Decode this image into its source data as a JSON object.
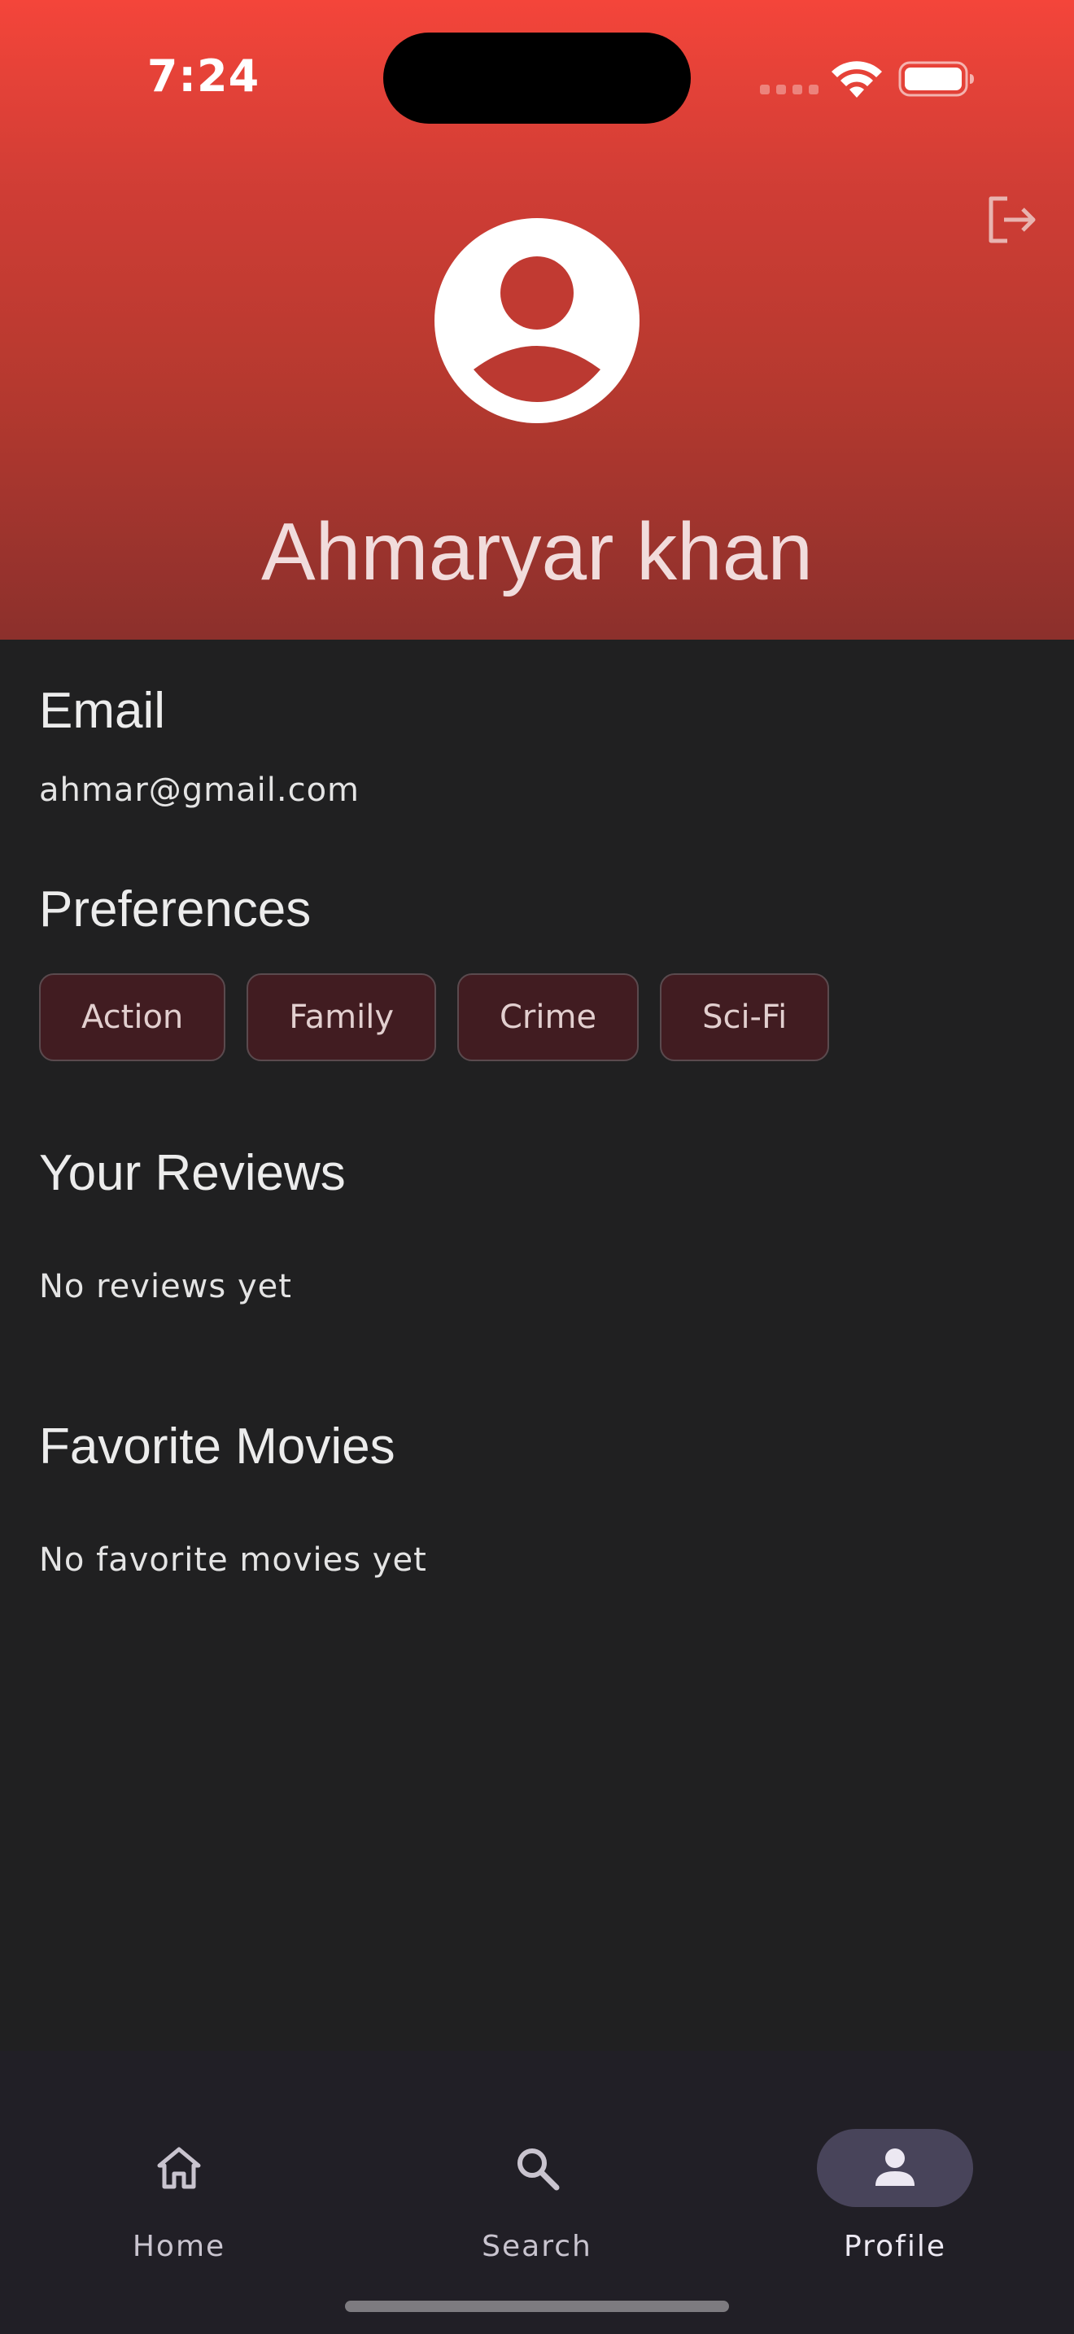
{
  "status_bar": {
    "time": "7:24"
  },
  "header": {
    "user_name": "Ahmaryar khan",
    "avatar_icon": "account-circle-icon",
    "logout_icon": "logout-icon",
    "gradient_top": "#f4453a",
    "gradient_bottom": "#8c302c"
  },
  "email_section": {
    "title": "Email",
    "value": "ahmar@gmail.com"
  },
  "preferences_section": {
    "title": "Preferences",
    "chips": [
      {
        "label": "Action"
      },
      {
        "label": "Family"
      },
      {
        "label": "Crime"
      },
      {
        "label": "Sci-Fi"
      }
    ]
  },
  "reviews_section": {
    "title": "Your Reviews",
    "empty_text": "No reviews yet"
  },
  "favorites_section": {
    "title": "Favorite Movies",
    "empty_text": "No favorite movies yet"
  },
  "bottom_nav": {
    "items": [
      {
        "label": "Home",
        "icon": "home-icon"
      },
      {
        "label": "Search",
        "icon": "search-icon"
      },
      {
        "label": "Profile",
        "icon": "person-icon",
        "active": true
      }
    ]
  },
  "colors": {
    "background": "#202021",
    "chip_background": "#411c21",
    "nav_background": "#211f26",
    "nav_active_pill": "#48445a"
  }
}
